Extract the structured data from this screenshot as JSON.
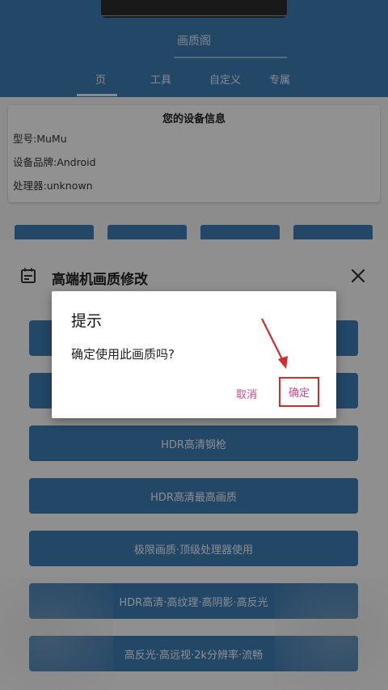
{
  "app": {
    "title": "画质阁",
    "tabs": [
      {
        "label": "页"
      },
      {
        "label": "工具"
      },
      {
        "label": "自定义"
      },
      {
        "label": "专属"
      }
    ]
  },
  "device_info": {
    "title": "您的设备信息",
    "model": "型号:MuMu",
    "brand": "设备品牌:Android",
    "processor": "处理器:unknown"
  },
  "panel": {
    "title": "高端机画质修改",
    "options": [
      {
        "label": ""
      },
      {
        "label": ""
      },
      {
        "label": "HDR高清钢枪"
      },
      {
        "label": "HDR高清最高画质"
      },
      {
        "label": "极限画质·顶级处理器使用"
      },
      {
        "label": "HDR高清·高纹理·高阴影·高反光"
      },
      {
        "label": "高反光·高远视·2k分辨率·流畅"
      }
    ]
  },
  "dialog": {
    "title": "提示",
    "message": "确定使用此画质吗?",
    "cancel_label": "取消",
    "confirm_label": "确定"
  },
  "colors": {
    "primary": "#3d7bb1",
    "accent_text": "#d0488a",
    "highlight_box": "#d42a2a"
  },
  "icons": {
    "panel_icon": "calendar-icon",
    "close": "close-icon",
    "annotation": "red-arrow-icon"
  }
}
